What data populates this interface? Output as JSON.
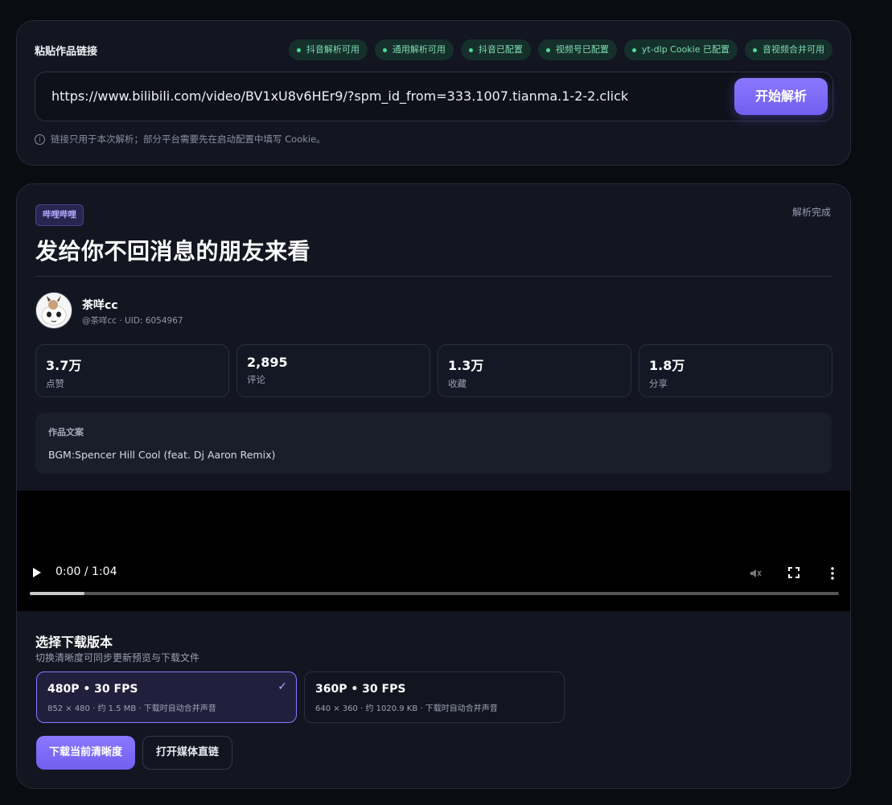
{
  "input_card": {
    "label": "粘贴作品链接",
    "chips": [
      "抖音解析可用",
      "通用解析可用",
      "抖音已配置",
      "视频号已配置",
      "yt-dlp Cookie 已配置",
      "音视频合并可用"
    ],
    "url_value": "https://www.bilibili.com/video/BV1xU8v6HEr9/?spm_id_from=333.1007.tianma.1-2-2.click",
    "parse_button": "开始解析",
    "hint": "链接只用于本次解析；部分平台需要先在启动配置中填写 Cookie。"
  },
  "result": {
    "platform": "哔哩哔哩",
    "status": "解析完成",
    "title": "发给你不回消息的朋友来看",
    "author": {
      "name": "茶咩cc",
      "meta": "@茶咩cc · UID: 6054967"
    },
    "stats": [
      {
        "value": "3.7万",
        "label": "点赞"
      },
      {
        "value": "2,895",
        "label": "评论"
      },
      {
        "value": "1.3万",
        "label": "收藏"
      },
      {
        "value": "1.8万",
        "label": "分享"
      }
    ],
    "description": {
      "label": "作品文案",
      "text": "BGM:Spencer Hill Cool (feat. Dj Aaron Remix)"
    },
    "player": {
      "time": "0:00 / 1:04",
      "progress": 0.068
    },
    "download": {
      "title": "选择下载版本",
      "subtitle": "切换清晰度可同步更新预览与下载文件",
      "options": [
        {
          "label": "480P • 30 FPS",
          "detail": "852 × 480 · 约 1.5 MB · 下载时自动合并声音",
          "selected": true
        },
        {
          "label": "360P • 30 FPS",
          "detail": "640 × 360 · 约 1020.9 KB · 下载时自动合并声音",
          "selected": false
        }
      ],
      "primary_button": "下载当前清晰度",
      "secondary_button": "打开媒体直链"
    }
  },
  "colors": {
    "accent": "#7c68fa",
    "chip_text": "#7fdcb4",
    "background": "#0b0c12",
    "card": "#131521"
  }
}
